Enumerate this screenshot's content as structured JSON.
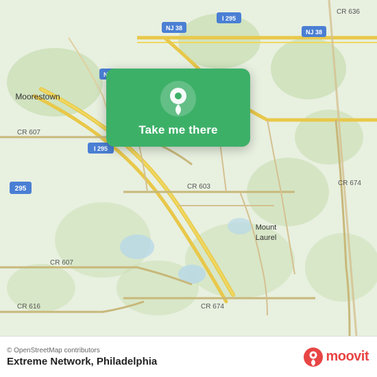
{
  "map": {
    "background_color": "#e8f0e0",
    "alt": "Map of Philadelphia area showing Mount Laurel and Moorestown NJ"
  },
  "card": {
    "button_label": "Take me there",
    "bg_color": "#3db068"
  },
  "footer": {
    "osm_credit": "© OpenStreetMap contributors",
    "location_name": "Extreme Network, Philadelphia",
    "moovit_label": "moovit"
  },
  "roads": [
    {
      "label": "I 295"
    },
    {
      "label": "NJ 38"
    },
    {
      "label": "CR 636"
    },
    {
      "label": "CR 607"
    },
    {
      "label": "CR 603"
    },
    {
      "label": "CR 674"
    },
    {
      "label": "CR 616"
    },
    {
      "label": "295"
    },
    {
      "label": "Moorestown"
    },
    {
      "label": "Mount Laurel"
    }
  ]
}
